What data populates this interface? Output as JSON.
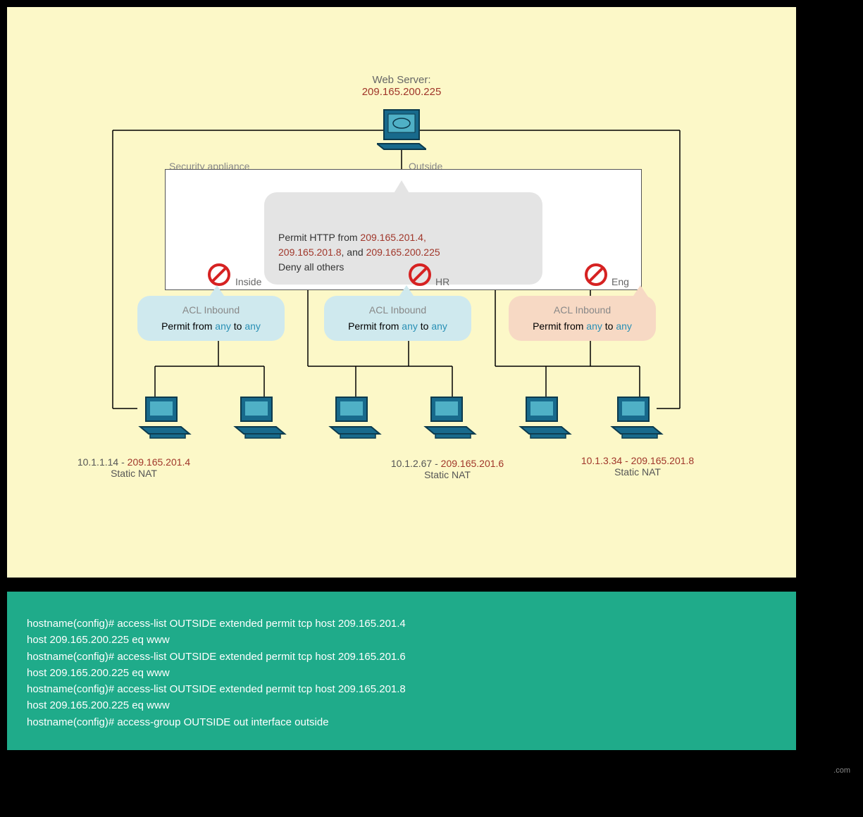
{
  "webserver": {
    "label": "Web Server:",
    "ip": "209.165.200.225"
  },
  "appliance": {
    "security_label": "Security appliance",
    "outside_label": "Outside",
    "inside_label": "Inside",
    "hr_label": "HR",
    "eng_label": "Eng"
  },
  "permit_box": {
    "prefix": "Permit HTTP from ",
    "ip1": "209.165.201.4,",
    "ip2": "209.165.201.8",
    "mid": ", and ",
    "ip3": "209.165.200.225",
    "deny": "Deny all others"
  },
  "acl": {
    "title": "ACL Inbound",
    "permit_prefix": "Permit from ",
    "any": "any",
    "to": " to "
  },
  "nat": {
    "left_ip1": "10.1.1.14",
    "left_ip2": "209.165.201.4",
    "mid_ip1": "10.1.2.67",
    "mid_ip2": "209.165.201.6",
    "right_ip1": "10.1.3.34",
    "right_ip2": "209.165.201.8",
    "label": "Static NAT",
    "sep": " - "
  },
  "cli": {
    "l1": "hostname(config)# access-list OUTSIDE extended permit tcp host 209.165.201.4",
    "l2": "host 209.165.200.225 eq www",
    "l3": "hostname(config)# access-list OUTSIDE extended permit tcp host 209.165.201.6",
    "l4": "host 209.165.200.225 eq www",
    "l5": "hostname(config)# access-list OUTSIDE extended permit tcp host 209.165.201.8",
    "l6": "host 209.165.200.225 eq www",
    "l7": "hostname(config)# access-group OUTSIDE out interface outside"
  },
  "watermark": ".com"
}
